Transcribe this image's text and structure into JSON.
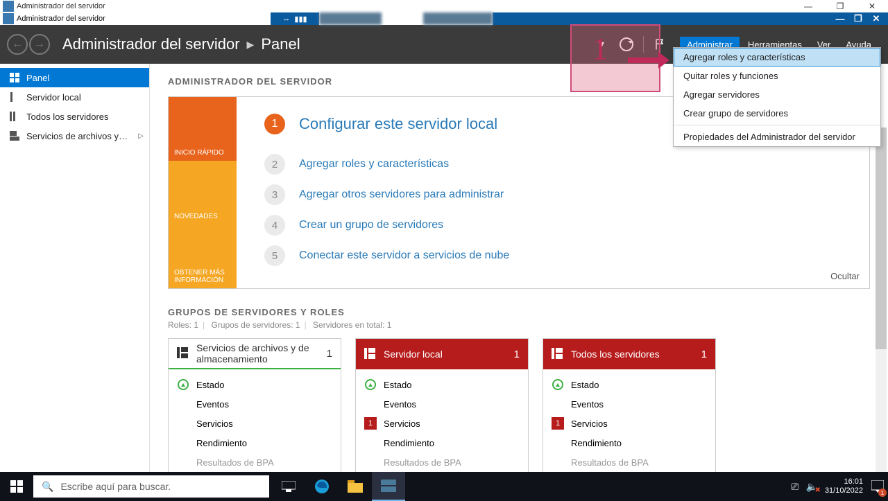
{
  "outer_title": "Administrador del servidor",
  "inner_title": "Administrador del servidor",
  "breadcrumb": {
    "root": "Administrador del servidor",
    "page": "Panel"
  },
  "header_menu": {
    "items": [
      "Administrar",
      "Herramientas",
      "Ver",
      "Ayuda"
    ],
    "selected_index": 0
  },
  "dropdown": {
    "items": [
      "Agregar roles y características",
      "Quitar roles y funciones",
      "Agregar servidores",
      "Crear grupo de servidores",
      "Propiedades del Administrador del servidor"
    ],
    "highlighted_index": 0,
    "separator_after_index": 3
  },
  "annotation": {
    "number": "1"
  },
  "sidebar": {
    "items": [
      {
        "label": "Panel",
        "active": true,
        "ico": "dash"
      },
      {
        "label": "Servidor local",
        "ico": "server"
      },
      {
        "label": "Todos los servidores",
        "ico": "servers"
      },
      {
        "label": "Servicios de archivos y…",
        "ico": "files",
        "expandable": true
      }
    ]
  },
  "main": {
    "page_title": "ADMINISTRADOR DEL SERVIDOR",
    "welcome_tabs": [
      "INICIO RÁPIDO",
      "NOVEDADES",
      "OBTENER MÁS INFORMACIÓN"
    ],
    "steps": [
      {
        "n": "1",
        "text": "Configurar este servidor local",
        "primary": true
      },
      {
        "n": "2",
        "text": "Agregar roles y características"
      },
      {
        "n": "3",
        "text": "Agregar otros servidores para administrar"
      },
      {
        "n": "4",
        "text": "Crear un grupo de servidores"
      },
      {
        "n": "5",
        "text": "Conectar este servidor a servicios de nube"
      }
    ],
    "hide_label": "Ocultar",
    "groups_title": "GRUPOS DE SERVIDORES Y ROLES",
    "groups_sub": {
      "roles": "Roles: 1",
      "groups": "Grupos de servidores: 1",
      "total": "Servidores en total: 1"
    }
  },
  "tiles": [
    {
      "title": "Servicios de archivos y de almacenamiento",
      "count": "1",
      "head_style": "dark",
      "rows": [
        {
          "ico": "up",
          "label": "Estado"
        },
        {
          "label": "Eventos"
        },
        {
          "label": "Servicios"
        },
        {
          "label": "Rendimiento"
        },
        {
          "label": "Resultados de BPA",
          "cut": true
        }
      ]
    },
    {
      "title": "Servidor local",
      "count": "1",
      "head_style": "red",
      "rows": [
        {
          "ico": "up",
          "label": "Estado"
        },
        {
          "label": "Eventos"
        },
        {
          "badge": "1",
          "label": "Servicios"
        },
        {
          "label": "Rendimiento"
        },
        {
          "label": "Resultados de BPA",
          "cut": true
        }
      ]
    },
    {
      "title": "Todos los servidores",
      "count": "1",
      "head_style": "red",
      "rows": [
        {
          "ico": "up",
          "label": "Estado"
        },
        {
          "label": "Eventos"
        },
        {
          "badge": "1",
          "label": "Servicios"
        },
        {
          "label": "Rendimiento"
        },
        {
          "label": "Resultados de BPA",
          "cut": true
        }
      ]
    }
  ],
  "taskbar": {
    "search_placeholder": "Escribe aquí para buscar.",
    "time": "16:01",
    "date": "31/10/2022",
    "notif_count": "1"
  }
}
